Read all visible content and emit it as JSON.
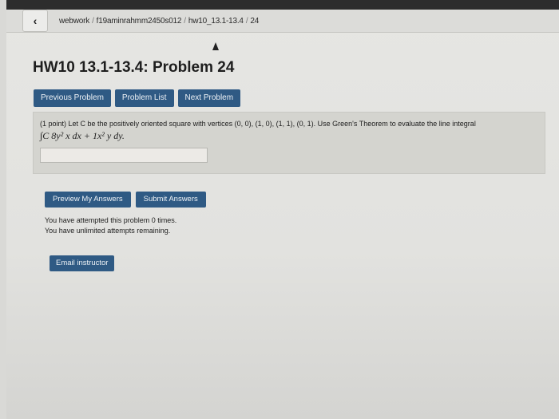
{
  "breadcrumb": {
    "items": [
      "webwork",
      "f19aminrahmm2450s012",
      "hw10_13.1-13.4",
      "24"
    ],
    "separator": "/"
  },
  "icons": {
    "back": "chevron-left-icon",
    "cursor": "mouse-pointer-icon"
  },
  "back_glyph": "‹",
  "page_title": "HW10 13.1-13.4: Problem 24",
  "nav": {
    "previous": "Previous Problem",
    "list": "Problem List",
    "next": "Next Problem"
  },
  "problem": {
    "text": "(1 point) Let C be the positively oriented square with vertices (0, 0), (1, 0), (1, 1), (0, 1). Use Green's Theorem to evaluate the line integral",
    "math": "∫C 8y² x dx + 1x² y dy.",
    "answer_value": ""
  },
  "actions": {
    "preview": "Preview My Answers",
    "submit": "Submit Answers"
  },
  "attempts": {
    "line1": "You have attempted this problem 0 times.",
    "line2": "You have unlimited attempts remaining."
  },
  "email_button": "Email instructor",
  "colors": {
    "button_blue": "#2f5a84",
    "top_bezel": "#2d2d2d"
  }
}
